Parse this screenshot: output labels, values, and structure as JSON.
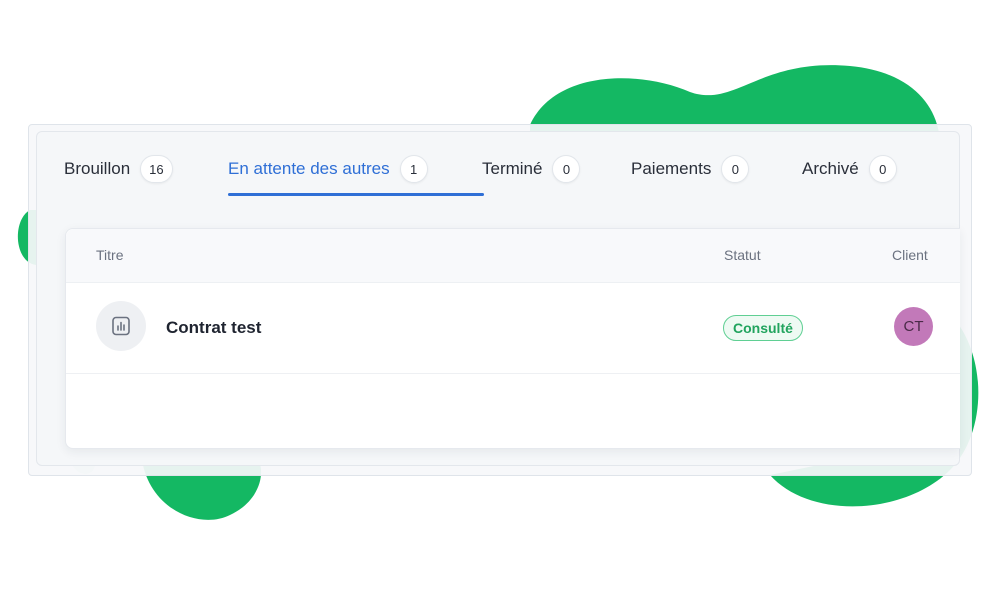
{
  "tabs": [
    {
      "label": "Brouillon",
      "count": "16"
    },
    {
      "label": "En attente des autres",
      "count": "1"
    },
    {
      "label": "Terminé",
      "count": "0"
    },
    {
      "label": "Paiements",
      "count": "0"
    },
    {
      "label": "Archivé",
      "count": "0"
    }
  ],
  "active_tab": "En attente des autres",
  "table": {
    "columns": {
      "title": "Titre",
      "status": "Statut",
      "client": "Client"
    },
    "rows": [
      {
        "title": "Contrat test",
        "status": "Consulté",
        "client_initials": "CT",
        "icon": "bar-chart-document-icon"
      }
    ]
  },
  "colors": {
    "accent": "#2f6fd6",
    "status_green": "#21a45e",
    "decor_blob": "#14b863",
    "avatar": "#c279b9"
  }
}
